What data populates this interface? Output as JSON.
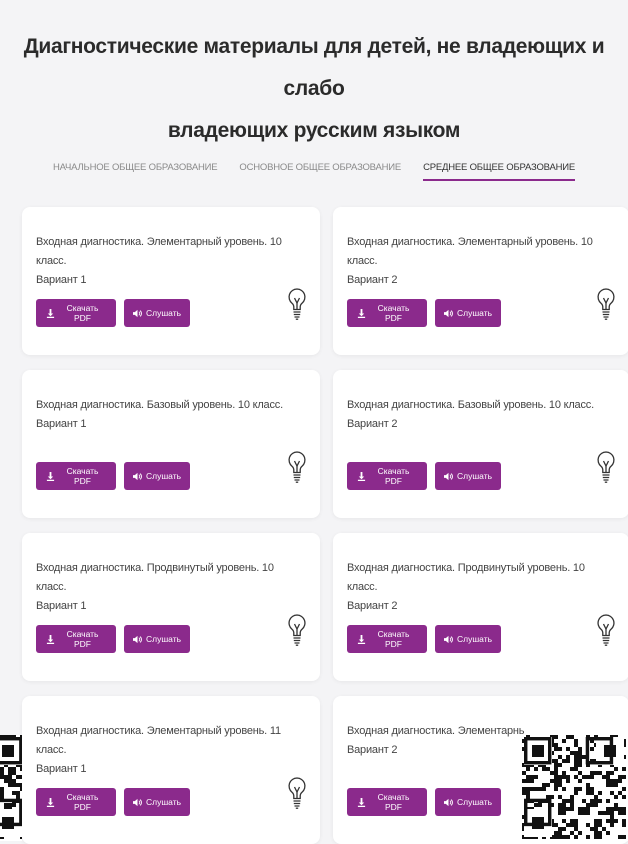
{
  "title_line1": "Диагностические материалы для детей, не владеющих и слабо",
  "title_line2": "владеющих русским языком",
  "tabs": [
    {
      "label": "НАЧАЛЬНОЕ ОБЩЕЕ ОБРАЗОВАНИЕ",
      "active": false
    },
    {
      "label": "ОСНОВНОЕ ОБЩЕЕ ОБРАЗОВАНИЕ",
      "active": false
    },
    {
      "label": "СРЕДНЕЕ ОБЩЕЕ ОБРАЗОВАНИЕ",
      "active": true
    }
  ],
  "buttons": {
    "download": "Скачать PDF",
    "listen": "Слушать"
  },
  "cards": [
    {
      "line1": "Входная диагностика. Элементарный уровень. 10 класс.",
      "line2": "Вариант 1"
    },
    {
      "line1": "Входная диагностика. Элементарный уровень. 10 класс.",
      "line2": "Вариант 2"
    },
    {
      "line1": "Входная диагностика. Базовый уровень. 10 класс.",
      "line2": "Вариант 1"
    },
    {
      "line1": "Входная диагностика. Базовый уровень. 10 класс.",
      "line2": "Вариант 2"
    },
    {
      "line1": "Входная диагностика. Продвинутый уровень. 10 класс.",
      "line2": "Вариант 1"
    },
    {
      "line1": "Входная диагностика. Продвинутый уровень. 10 класс.",
      "line2": "Вариант 2"
    },
    {
      "line1": "Входная диагностика. Элементарный уровень. 11 класс.",
      "line2": "Вариант 1"
    },
    {
      "line1": "Входная диагностика. Элементарнь",
      "line2": "Вариант 2"
    }
  ],
  "colors": {
    "accent": "#8b2a8c",
    "background": "#f4f4f6",
    "card": "#ffffff"
  },
  "icons": {
    "download": "download-icon",
    "listen": "speaker-icon",
    "card": "lightbulb-icon"
  }
}
